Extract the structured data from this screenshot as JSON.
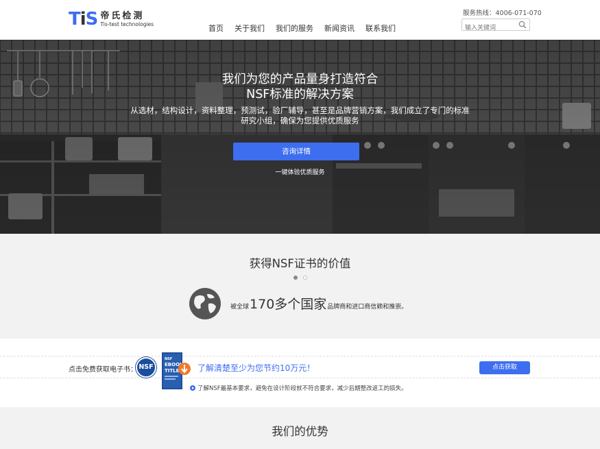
{
  "header": {
    "logo_mark": {
      "t": "T",
      "i": "i",
      "s": "S"
    },
    "logo_cn": "帝氏检测",
    "logo_en": "Tis-test technologies",
    "hotline": "服务热线：4006-071-070",
    "search_placeholder": "输入关键词",
    "nav": [
      "首页",
      "关于我们",
      "我们的服务",
      "新闻资讯",
      "联系我们"
    ]
  },
  "hero": {
    "title_line1": "我们为您的产品量身打造符合",
    "title_line2": "NSF标准的解决方案",
    "sub_line1": "从选材，结构设计，资料整理，预测试，验厂辅导，甚至是品牌营销方案，我们成立了专门的标准",
    "sub_line2": "研究小组，确保为您提供优质服务",
    "button": "咨询详情",
    "note": "一键体验优质服务"
  },
  "value": {
    "title": "获得NSF证书的价值",
    "prefix": "被全球",
    "highlight": "170多个国家",
    "suffix": "品牌商和进口商信赖和推崇。"
  },
  "ebook": {
    "label": "点击免费获取电子书：",
    "badge": "NSF",
    "cover_text": {
      "top": "NSF",
      "mid": "EBOOK",
      "bot": "TITLE"
    },
    "promo": "了解清楚至少为您节约10万元！",
    "button": "点击获取",
    "bullet": "了解NSF最基本要求，避免在设计阶段就不符合要求，减少后期整改返工的损失。"
  },
  "advantages": {
    "title": "我们的优势"
  },
  "colors": {
    "accent": "#3d6ef0",
    "nsf_blue": "#1a4e9c",
    "section_bg": "#f2f2f2"
  }
}
